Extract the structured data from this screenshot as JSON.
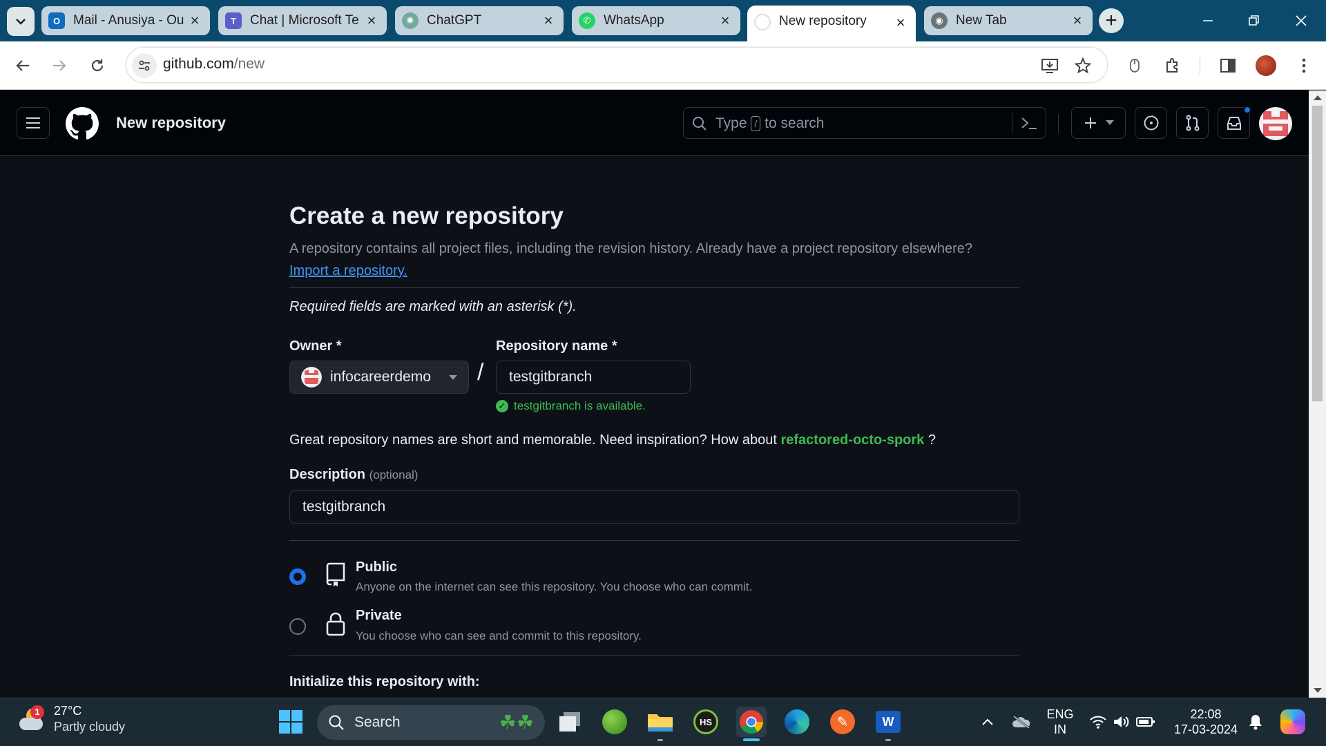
{
  "browser": {
    "tabs": [
      {
        "title": "Mail - Anusiya - Ou",
        "icon": "outlook-icon",
        "color": "#0f6cbd"
      },
      {
        "title": "Chat | Microsoft Te",
        "icon": "teams-icon",
        "color": "#5b5fc7"
      },
      {
        "title": "ChatGPT",
        "icon": "chatgpt-icon",
        "color": "#74aa9c"
      },
      {
        "title": "WhatsApp",
        "icon": "whatsapp-icon",
        "color": "#25d366"
      },
      {
        "title": "New repository",
        "icon": "github-icon",
        "color": "#ffffff"
      },
      {
        "title": "New Tab",
        "icon": "chrome-icon",
        "color": "#5f6368"
      }
    ],
    "url_host": "github.com",
    "url_path": "/new"
  },
  "github": {
    "header_title": "New repository",
    "search_prefix": "Type",
    "search_key": "/",
    "search_suffix": "to search"
  },
  "form": {
    "page_title": "Create a new repository",
    "intro_text": "A repository contains all project files, including the revision history. Already have a project repository elsewhere?",
    "import_link": "Import a repository.",
    "required_note": "Required fields are marked with an asterisk (*).",
    "owner_label": "Owner *",
    "owner_value": "infocareerdemo",
    "slash": "/",
    "repo_label": "Repository name *",
    "repo_value": "testgitbranch",
    "availability": "testgitbranch is available.",
    "hint_text": "Great repository names are short and memorable. Need inspiration? How about",
    "suggestion": "refactored-octo-spork",
    "hint_end": "?",
    "description_label": "Description",
    "optional_label": "(optional)",
    "description_value": "testgitbranch",
    "visibility": [
      {
        "title": "Public",
        "desc": "Anyone on the internet can see this repository. You choose who can commit.",
        "selected": true
      },
      {
        "title": "Private",
        "desc": "You choose who can see and commit to this repository.",
        "selected": false
      }
    ],
    "init_heading": "Initialize this repository with:"
  },
  "taskbar": {
    "weather_temp": "27°C",
    "weather_cond": "Partly cloudy",
    "weather_badge": "1",
    "search_label": "Search",
    "lang_1": "ENG",
    "lang_2": "IN",
    "time": "22:08",
    "date": "17-03-2024",
    "hs_label": "HS"
  },
  "colors": {
    "accent": "#1f6feb",
    "success": "#3fb950",
    "link": "#4493f8"
  }
}
